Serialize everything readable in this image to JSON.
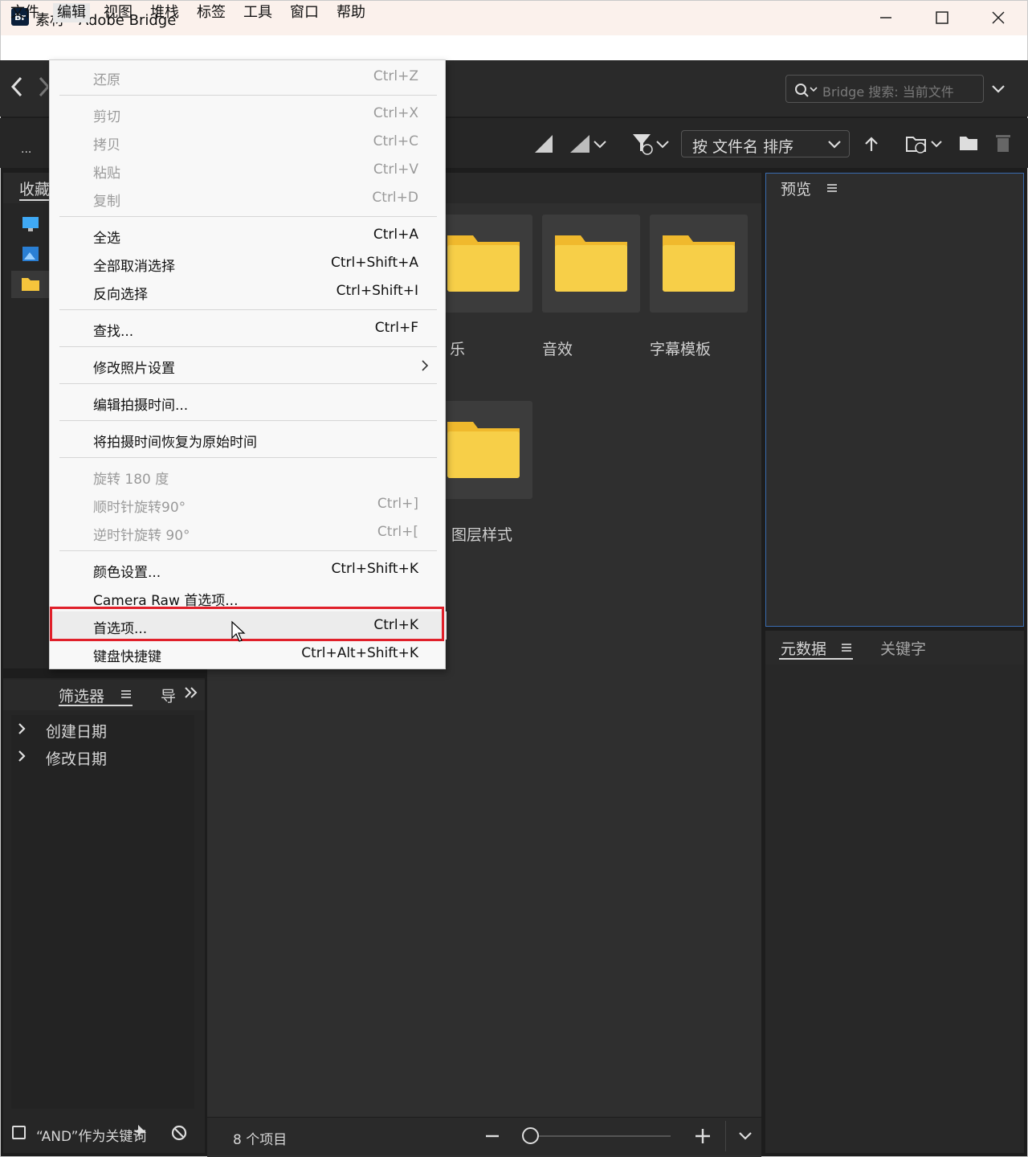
{
  "window": {
    "app_icon": "Br",
    "title": "素材 - Adobe Bridge",
    "controls": [
      "minimize-icon",
      "maximize-icon",
      "close-icon"
    ]
  },
  "menubar": [
    "文件",
    "编辑",
    "视图",
    "堆栈",
    "标签",
    "工具",
    "窗口",
    "帮助"
  ],
  "active_menu": "编辑",
  "search": {
    "placeholder": "Bridge 搜索: 当前文件"
  },
  "toolbar": {
    "path_ellipsis": "...",
    "sort_label": "按 文件名 排序"
  },
  "left_panel": {
    "tab": "收藏",
    "filter_tab": "筛选器",
    "nav_tab": "导",
    "filters": [
      "创建日期",
      "修改日期"
    ],
    "and_keyword_label": "“AND”作为关键词"
  },
  "content": {
    "folders": [
      {
        "label": "乐",
        "partial": true
      },
      {
        "label": "音效"
      },
      {
        "label": "字幕模板"
      },
      {
        "label": "图层样式",
        "partial": true
      }
    ],
    "status_count": "8 个项目"
  },
  "preview_panel": {
    "tab": "预览"
  },
  "meta_panel": {
    "tabs": [
      "元数据",
      "关键字"
    ]
  },
  "edit_menu": {
    "items": [
      {
        "label": "还原",
        "shortcut": "Ctrl+Z",
        "disabled": true
      },
      {
        "label": "剪切",
        "shortcut": "Ctrl+X",
        "disabled": true
      },
      {
        "label": "拷贝",
        "shortcut": "Ctrl+C",
        "disabled": true
      },
      {
        "label": "粘贴",
        "shortcut": "Ctrl+V",
        "disabled": true
      },
      {
        "label": "复制",
        "shortcut": "Ctrl+D",
        "disabled": true
      },
      {
        "label": "全选",
        "shortcut": "Ctrl+A",
        "disabled": false
      },
      {
        "label": "全部取消选择",
        "shortcut": "Ctrl+Shift+A",
        "disabled": false
      },
      {
        "label": "反向选择",
        "shortcut": "Ctrl+Shift+I",
        "disabled": false
      },
      {
        "label": "查找...",
        "shortcut": "Ctrl+F",
        "disabled": false
      },
      {
        "label": "修改照片设置",
        "shortcut": "",
        "submenu": true,
        "disabled": false
      },
      {
        "label": "编辑拍摄时间...",
        "shortcut": "",
        "disabled": false
      },
      {
        "label": "将拍摄时间恢复为原始时间",
        "shortcut": "",
        "disabled": false
      },
      {
        "label": "旋转 180 度",
        "shortcut": "",
        "disabled": true
      },
      {
        "label": "顺时针旋转90°",
        "shortcut": "Ctrl+]",
        "disabled": true
      },
      {
        "label": "逆时针旋转 90°",
        "shortcut": "Ctrl+[",
        "disabled": true
      },
      {
        "label": "颜色设置...",
        "shortcut": "Ctrl+Shift+K",
        "disabled": false
      },
      {
        "label": "Camera Raw 首选项...",
        "shortcut": "",
        "disabled": false
      },
      {
        "label": "首选项...",
        "shortcut": "Ctrl+K",
        "disabled": false,
        "highlighted": true
      },
      {
        "label": "键盘快捷键",
        "shortcut": "Ctrl+Alt+Shift+K",
        "disabled": false
      }
    ]
  },
  "colors": {
    "highlight_box": "#e0202a",
    "folder_yellow": "#f7cf48",
    "preview_border": "#3a6cb0"
  }
}
